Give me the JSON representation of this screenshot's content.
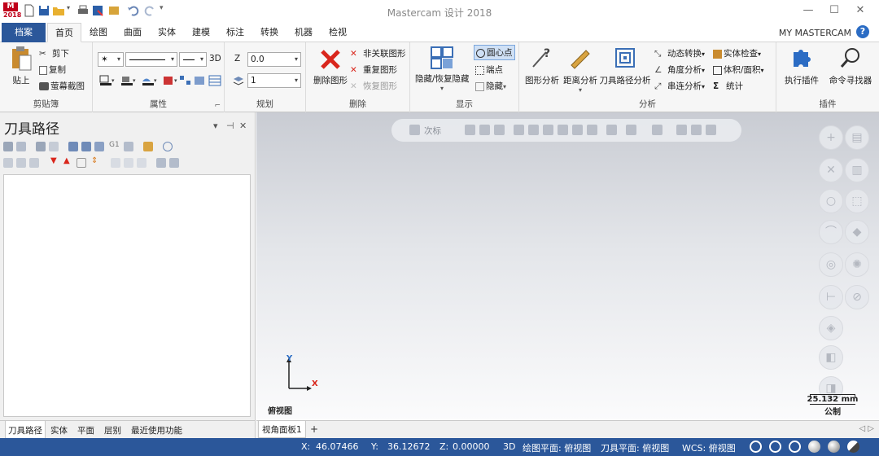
{
  "window": {
    "title": "Mastercam 设计 2018",
    "logo_text": "2018"
  },
  "tabs": [
    "档案",
    "首页",
    "绘图",
    "曲面",
    "实体",
    "建模",
    "标注",
    "转换",
    "机器",
    "检视"
  ],
  "active_tab": "首页",
  "account_label": "MY MASTERCAM",
  "help_label": "?",
  "ribbon": {
    "clipboard": {
      "label": "剪贴簿",
      "paste": "贴上",
      "cut": "剪下",
      "copy": "复制",
      "screenshot": "萤幕截图"
    },
    "attributes": {
      "label": "属性",
      "three_d": "3D",
      "launcher": "⌐"
    },
    "planning": {
      "label": "规划",
      "z_label": "Z",
      "z_value": "0.0",
      "level_value": "1"
    },
    "delete": {
      "label": "删除",
      "delete_entities": "删除图形",
      "unassociate": "非关联图形",
      "duplicate": "重复图形",
      "restore": "恢复图形"
    },
    "display": {
      "label": "显示",
      "hide_unhide": "隐藏/恢复隐藏",
      "center_point": "圆心点",
      "endpoint": "端点",
      "hide": "隐藏"
    },
    "analyze": {
      "label": "分析",
      "entity": "图形分析",
      "distance": "距离分析",
      "toolpath": "刀具路径分析",
      "dynamic": "动态转换",
      "angle": "角度分析",
      "chain": "串连分析",
      "solid_check": "实体检查",
      "volume_area": "体积/面积",
      "statistics": "统计"
    },
    "addins": {
      "label": "插件",
      "run_addin": "执行插件",
      "command_finder": "命令寻找器"
    }
  },
  "panel": {
    "title": "刀具路径",
    "pin": "⊣",
    "close": "✕",
    "dropdown": "▾",
    "g1": "G1",
    "bottom_tabs": [
      "刀具路径",
      "实体",
      "平面",
      "层别",
      "最近使用功能"
    ]
  },
  "viewport": {
    "toolbar_label": "次标",
    "view_name": "俯视图",
    "axis_x": "X",
    "axis_y": "Y",
    "scale_value": "25.132 mm",
    "scale_unit": "公制",
    "tab_label": "视角面板1",
    "add_tab": "+"
  },
  "status": {
    "x_label": "X:",
    "x_value": "46.07466",
    "y_label": "Y:",
    "y_value": "36.12672",
    "z_label": "Z:",
    "z_value": "0.00000",
    "mode": "3D",
    "cplane": "绘图平面: 俯视图",
    "tplane": "刀具平面: 俯视图",
    "wcs": "WCS: 俯视图"
  },
  "colors": {
    "accent": "#2b579a",
    "delete_red": "#d9261c",
    "help_blue": "#2b6cc4"
  }
}
